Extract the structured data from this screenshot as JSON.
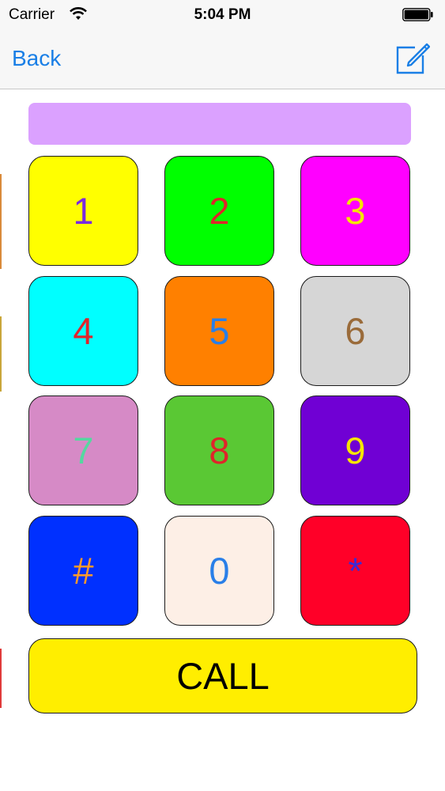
{
  "status_bar": {
    "carrier": "Carrier",
    "time": "5:04 PM"
  },
  "nav": {
    "back_label": "Back",
    "compose_icon": "compose-icon"
  },
  "display": {
    "value": "",
    "color": "#dba1ff"
  },
  "keys": [
    {
      "label": "1",
      "bg": "#ffff00",
      "fg": "#7a2be0"
    },
    {
      "label": "2",
      "bg": "#00ff00",
      "fg": "#e0242a"
    },
    {
      "label": "3",
      "bg": "#ff00ff",
      "fg": "#f5e500"
    },
    {
      "label": "4",
      "bg": "#00ffff",
      "fg": "#e0242a"
    },
    {
      "label": "5",
      "bg": "#ff8000",
      "fg": "#2a7fe8"
    },
    {
      "label": "6",
      "bg": "#d6d6d6",
      "fg": "#9a6b3a"
    },
    {
      "label": "7",
      "bg": "#d68ac6",
      "fg": "#55d7a0"
    },
    {
      "label": "8",
      "bg": "#5ac834",
      "fg": "#e0242a"
    },
    {
      "label": "9",
      "bg": "#7000d4",
      "fg": "#f5e500"
    },
    {
      "label": "#",
      "bg": "#0030ff",
      "fg": "#ff9a2a"
    },
    {
      "label": "0",
      "bg": "#fdefe6",
      "fg": "#2a7fe8"
    },
    {
      "label": "*",
      "bg": "#ff0028",
      "fg": "#3a2bd6"
    }
  ],
  "call": {
    "label": "CALL",
    "bg": "#ffee00"
  }
}
